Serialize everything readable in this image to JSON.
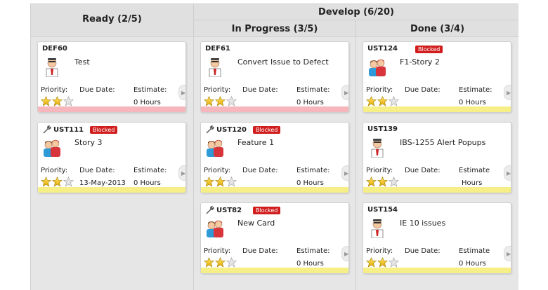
{
  "columns": {
    "ready": {
      "label": "Ready (2/5)"
    },
    "develop": {
      "label": "Develop (6/20)"
    },
    "in_progress": {
      "label": "In Progress (3/5)"
    },
    "done": {
      "label": "Done (3/4)"
    }
  },
  "labels": {
    "priority": "Priority:",
    "due_date": "Due Date:",
    "estimate": "Estimate:",
    "estimate_alt": "Estimate",
    "blocked": "Blocked"
  },
  "cards": {
    "def60": {
      "id": "DEF60",
      "title": "Test",
      "due": "",
      "estimate": "0 Hours",
      "stars": 2,
      "bar": "pink"
    },
    "ust111": {
      "id": "UST111",
      "title": "Story 3",
      "due": "13-May-2013",
      "estimate": "0 Hours",
      "stars": 2,
      "bar": "yellow"
    },
    "def61": {
      "id": "DEF61",
      "title": "Convert Issue to Defect",
      "due": "",
      "estimate": "0 Hours",
      "stars": 2,
      "bar": "pink"
    },
    "ust120": {
      "id": "UST120",
      "title": "Feature 1",
      "due": "",
      "estimate": "0 Hours",
      "stars": 2,
      "bar": "yellow"
    },
    "ust82": {
      "id": "UST82",
      "title": "New Card",
      "due": "",
      "estimate": "0 Hours",
      "stars": 2,
      "bar": "yellow"
    },
    "ust124": {
      "id": "UST124",
      "title": "F1-Story 2",
      "due": "",
      "estimate": "0 Hours",
      "stars": 2,
      "bar": "yellow"
    },
    "ust139": {
      "id": "UST139",
      "title": "IBS-1255 Alert Popups",
      "due": "",
      "estimate": "Hours",
      "stars": 2,
      "bar": "yellow"
    },
    "ust154": {
      "id": "UST154",
      "title": "IE 10 issues",
      "due": "",
      "estimate": "0 Hours",
      "stars": 2,
      "bar": "yellow"
    }
  },
  "colors": {
    "blocked": "#d11d1d",
    "defect_bar": "#f5b7bb",
    "story_bar": "#f6ee86",
    "star_filled": "#f2c200",
    "star_empty": "#c8c8c8"
  }
}
